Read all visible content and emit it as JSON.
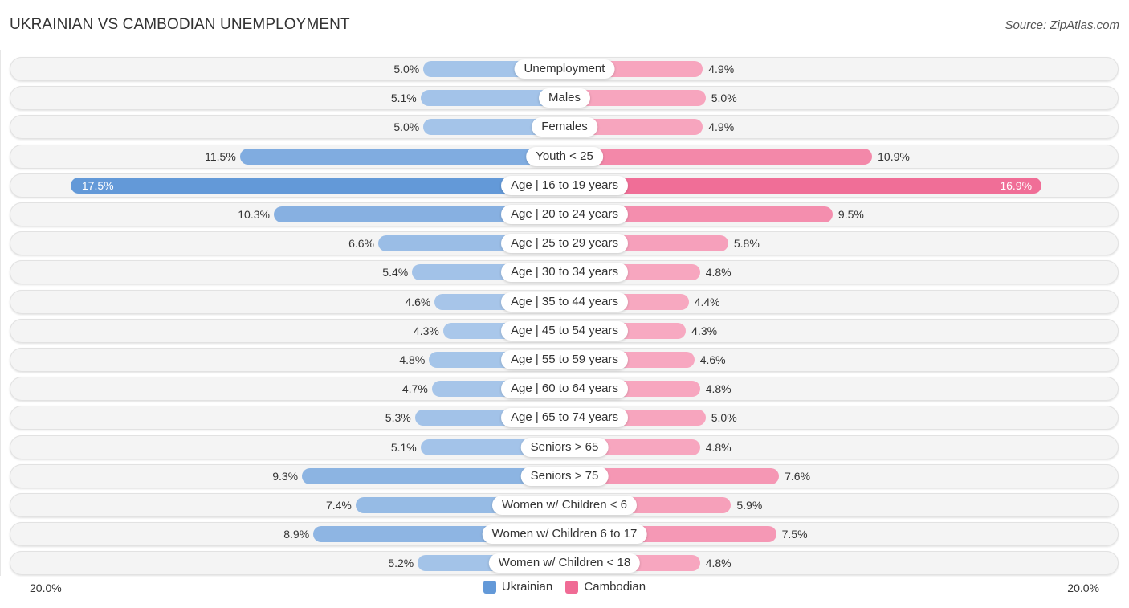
{
  "title": "UKRAINIAN VS CAMBODIAN UNEMPLOYMENT",
  "source": "Source: ZipAtlas.com",
  "colors": {
    "ukrainian_light": "#a9c7ea",
    "ukrainian_strong": "#6399d8",
    "cambodian_light": "#f7a9c1",
    "cambodian_strong": "#f06b95"
  },
  "legend": [
    {
      "name": "Ukrainian",
      "color": "#6399d8"
    },
    {
      "name": "Cambodian",
      "color": "#f06b95"
    }
  ],
  "axis": {
    "left_label": "20.0%",
    "right_label": "20.0%"
  },
  "chart_data": {
    "type": "bar",
    "orientation": "horizontal-diverging",
    "title": "UKRAINIAN VS CAMBODIAN UNEMPLOYMENT",
    "xlabel": "",
    "ylabel": "",
    "xlim": [
      -20,
      20
    ],
    "unit": "%",
    "legend_position": "bottom-center",
    "categories": [
      "Unemployment",
      "Males",
      "Females",
      "Youth < 25",
      "Age | 16 to 19 years",
      "Age | 20 to 24 years",
      "Age | 25 to 29 years",
      "Age | 30 to 34 years",
      "Age | 35 to 44 years",
      "Age | 45 to 54 years",
      "Age | 55 to 59 years",
      "Age | 60 to 64 years",
      "Age | 65 to 74 years",
      "Seniors > 65",
      "Seniors > 75",
      "Women w/ Children < 6",
      "Women w/ Children 6 to 17",
      "Women w/ Children < 18"
    ],
    "series": [
      {
        "name": "Ukrainian",
        "side": "left",
        "values": [
          5.0,
          5.1,
          5.0,
          11.5,
          17.5,
          10.3,
          6.6,
          5.4,
          4.6,
          4.3,
          4.8,
          4.7,
          5.3,
          5.1,
          9.3,
          7.4,
          8.9,
          5.2
        ],
        "labels": [
          "5.0%",
          "5.1%",
          "5.0%",
          "11.5%",
          "17.5%",
          "10.3%",
          "6.6%",
          "5.4%",
          "4.6%",
          "4.3%",
          "4.8%",
          "4.7%",
          "5.3%",
          "5.1%",
          "9.3%",
          "7.4%",
          "8.9%",
          "5.2%"
        ]
      },
      {
        "name": "Cambodian",
        "side": "right",
        "values": [
          4.9,
          5.0,
          4.9,
          10.9,
          16.9,
          9.5,
          5.8,
          4.8,
          4.4,
          4.3,
          4.6,
          4.8,
          5.0,
          4.8,
          7.6,
          5.9,
          7.5,
          4.8
        ],
        "labels": [
          "4.9%",
          "5.0%",
          "4.9%",
          "10.9%",
          "16.9%",
          "9.5%",
          "5.8%",
          "4.8%",
          "4.4%",
          "4.3%",
          "4.6%",
          "4.8%",
          "5.0%",
          "4.8%",
          "7.6%",
          "5.9%",
          "7.5%",
          "4.8%"
        ]
      }
    ]
  }
}
